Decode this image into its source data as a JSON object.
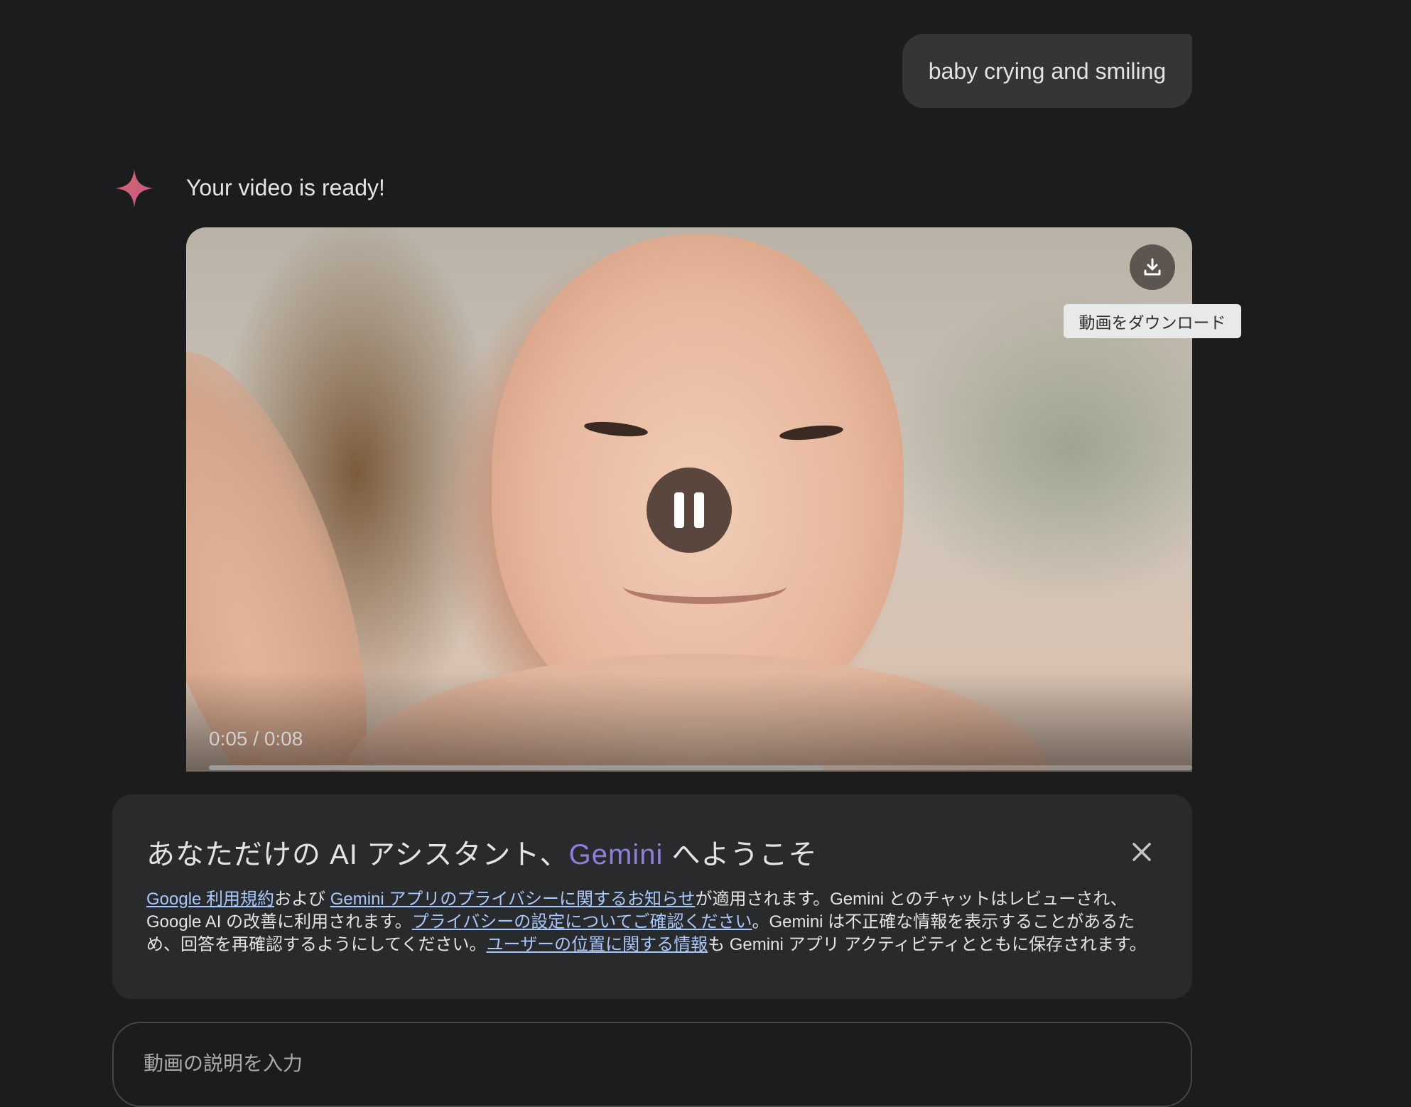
{
  "chat": {
    "user_message": "baby crying and smiling",
    "response_text": "Your video is ready!"
  },
  "video": {
    "time_display": "0:05 / 0:08",
    "progress_fraction": 0.625,
    "download_tooltip": "動画をダウンロード",
    "icons": [
      "download-icon",
      "pause-icon"
    ]
  },
  "welcome": {
    "title_prefix": "あなただけの AI アシスタント、",
    "title_brand": "Gemini",
    "title_suffix": " へようこそ",
    "link_terms": "Google 利用規約",
    "text_and": "および ",
    "link_privacy_notice": "Gemini アプリのプライバシーに関するお知らせ",
    "text_applies": "が適用されます。Gemini とのチャットはレビューされ、Google AI の改善に利用されます。",
    "link_privacy_settings": "プライバシーの設定についてご確認ください",
    "text_inaccurate": "。Gemini は不正確な情報を表示することがあるため、回答を再確認するようにしてください。",
    "link_location": "ユーザーの位置に関する情報",
    "text_saved": "も Gemini アプリ アクティビティとともに保存されます。",
    "brand_color": "#8a80e0"
  },
  "prompt": {
    "placeholder": "動画の説明を入力"
  }
}
